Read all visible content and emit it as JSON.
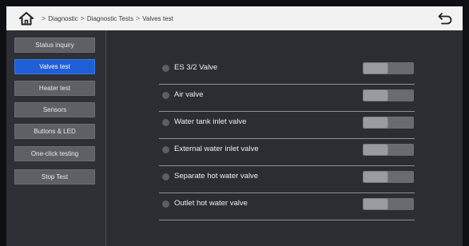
{
  "breadcrumb": {
    "items": [
      "Diagnostic",
      "Diagnostic Tests",
      "Valves test"
    ]
  },
  "sidebar": {
    "items": [
      {
        "label": "Status inquiry",
        "active": false
      },
      {
        "label": "Valves test",
        "active": true
      },
      {
        "label": "Heater test",
        "active": false
      },
      {
        "label": "Sensors",
        "active": false
      },
      {
        "label": "Buttons & LED",
        "active": false
      },
      {
        "label": "One-click testing",
        "active": false
      },
      {
        "label": "Stop Test",
        "active": false
      }
    ]
  },
  "valves": [
    {
      "label": "ES 3/2 Valve",
      "on": false
    },
    {
      "label": "Air valve",
      "on": false
    },
    {
      "label": "Water tank inlet valve",
      "on": false
    },
    {
      "label": "External water inlet valve",
      "on": false
    },
    {
      "label": "Separate hot water valve",
      "on": false
    },
    {
      "label": "Outlet hot water valve",
      "on": false
    }
  ],
  "icons": {
    "home": "home-icon",
    "back": "back-arrow-icon",
    "status_dot": "status-dot-icon"
  },
  "colors": {
    "active_tab": "#1f5fd6",
    "header_bg": "#f2f2f2",
    "panel_bg": "#2c2d33"
  }
}
